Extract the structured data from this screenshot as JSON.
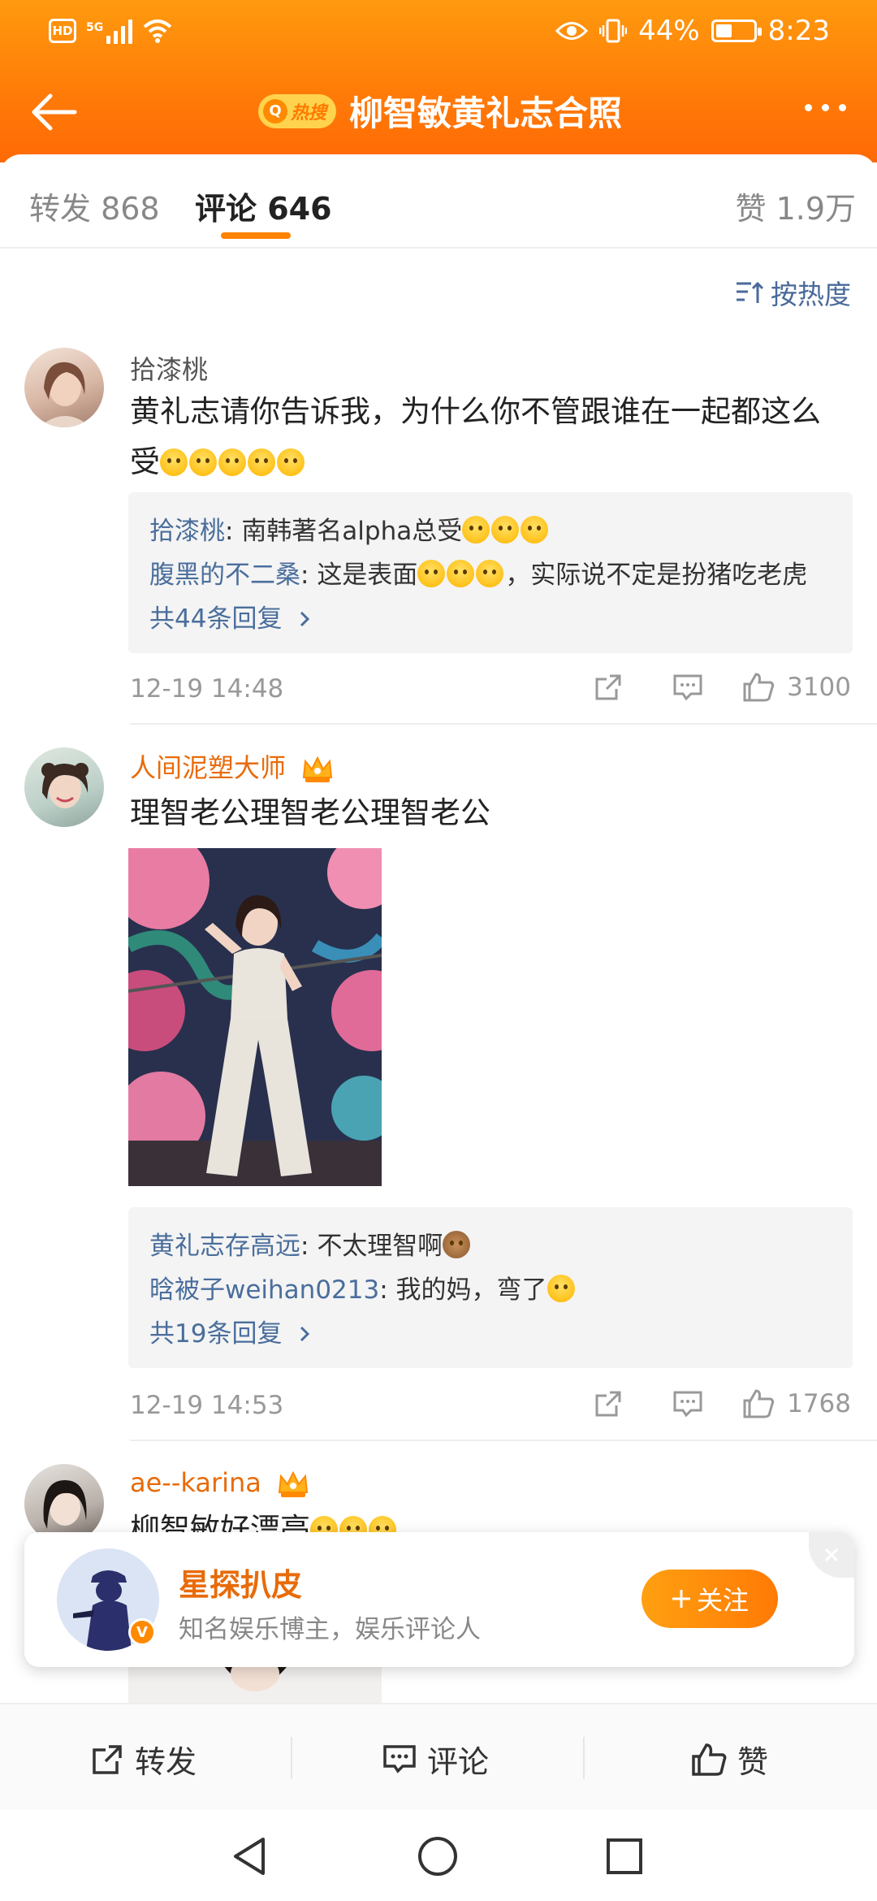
{
  "status_bar": {
    "hd": "HD",
    "network": "5G",
    "battery_text": "44%",
    "battery_level": 0.44,
    "time": "8:23"
  },
  "nav": {
    "hot_badge_label": "热搜",
    "title": "柳智敏黄礼志合照"
  },
  "tabs": {
    "repost": "转发 868",
    "comments": "评论 646",
    "likes": "赞 1.9万"
  },
  "sort_label": "按热度",
  "comments": [
    {
      "user": "拾漆桃",
      "text_line1": "黄礼志请你告诉我，为什么你不管跟谁在一起都这么",
      "text_line2": "受",
      "emoji_count": 5,
      "replies": [
        {
          "name": "拾漆桃",
          "sep": ": ",
          "text": "南韩著名alpha总受"
        },
        {
          "name": "腹黑的不二桑",
          "sep": ": ",
          "text": "这是表面",
          "text_after": "，实际说不定是扮猪吃老虎"
        }
      ],
      "more_replies": "共44条回复",
      "time": "12-19 14:48",
      "likes": "3100"
    },
    {
      "user": "人间泥塑大师",
      "text": "理智老公理智老公理智老公",
      "replies": [
        {
          "name": "黄礼志存高远",
          "sep": ": ",
          "text": "不太理智啊"
        },
        {
          "name": "晗被子weihan0213",
          "sep": ": ",
          "text": "我的妈，弯了"
        }
      ],
      "more_replies": "共19条回复",
      "time": "12-19 14:53",
      "likes": "1768"
    },
    {
      "user": "ae--karina",
      "text": "柳智敏好漂亮"
    }
  ],
  "popup": {
    "name": "星探扒皮",
    "desc": "知名娱乐博主，娱乐评论人",
    "follow": "关注",
    "badge": "V"
  },
  "bottom_bar": {
    "repost": "转发",
    "comment": "评论",
    "like": "赞"
  },
  "colors": {
    "brand_orange": "#ff7a08",
    "link_blue": "#4a6e9c",
    "vip_orange": "#e86b0a"
  }
}
